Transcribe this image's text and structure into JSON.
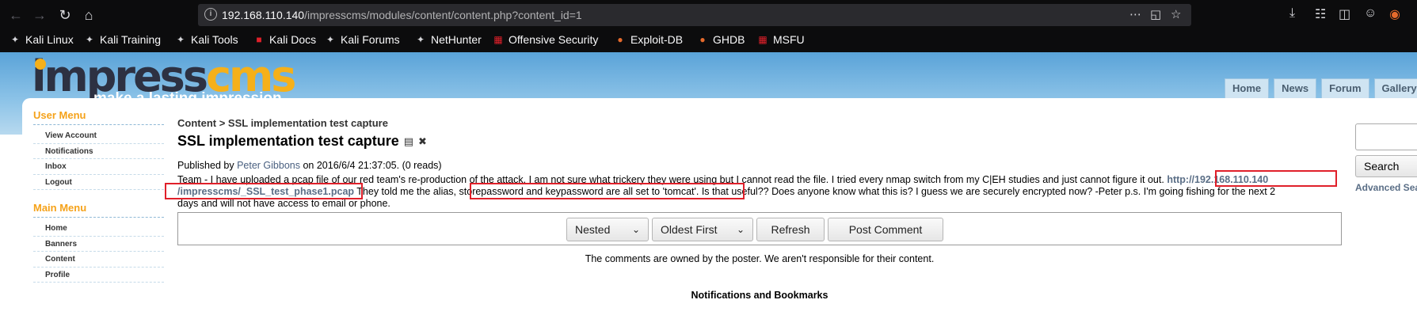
{
  "browser": {
    "url_host": "192.168.110.140",
    "url_path": "/impresscms/modules/content/content.php?content_id=1",
    "bookmarks": [
      "Kali Linux",
      "Kali Training",
      "Kali Tools",
      "Kali Docs",
      "Kali Forums",
      "NetHunter",
      "Offensive Security",
      "Exploit-DB",
      "GHDB",
      "MSFU"
    ]
  },
  "site": {
    "logo_part1": "impress",
    "logo_part2": "cms",
    "tagline": "make a lasting impression",
    "tabs": [
      "Home",
      "News",
      "Forum",
      "Gallery"
    ]
  },
  "sidebar": {
    "user_menu_title": "User Menu",
    "user_menu": [
      "View Account",
      "Notifications",
      "Inbox",
      "Logout"
    ],
    "main_menu_title": "Main Menu",
    "main_menu": [
      "Home",
      "Banners",
      "Content",
      "Profile"
    ]
  },
  "article": {
    "breadcrumb": "Content > SSL implementation test capture",
    "title": "SSL implementation test capture",
    "published_prefix": "Published by ",
    "author": "Peter Gibbons",
    "published_suffix": " on 2016/6/4 21:37:05. (0 reads)",
    "line1": "Team - I have uploaded a pcap file of our red team's re-production of the attack. I am not sure what trickery they were using but I cannot read the file. I tried every nmap switch from my C|EH studies and just cannot figure it out. ",
    "link_part1": "http://192.168.110.140",
    "link_part2": "/impresscms/_SSL_test_phase1.pcap",
    "line2_a": " They told me the alias, ",
    "line2_highlight": "storepassword and keypassword are all set to 'tomcat'",
    "line2_b": ". Is that useful?? Does anyone know what this is? I guess we are securely encrypted now? -Peter p.s. I'm going fishing for the next 2",
    "line3": "days and will not have access to email or phone."
  },
  "comments": {
    "mode": "Nested",
    "order": "Oldest First",
    "refresh": "Refresh",
    "post": "Post Comment",
    "disclaimer": "The comments are owned by the poster. We aren't responsible for their content."
  },
  "notifications_title": "Notifications and Bookmarks",
  "search": {
    "button": "Search",
    "advanced": "Advanced Search"
  }
}
